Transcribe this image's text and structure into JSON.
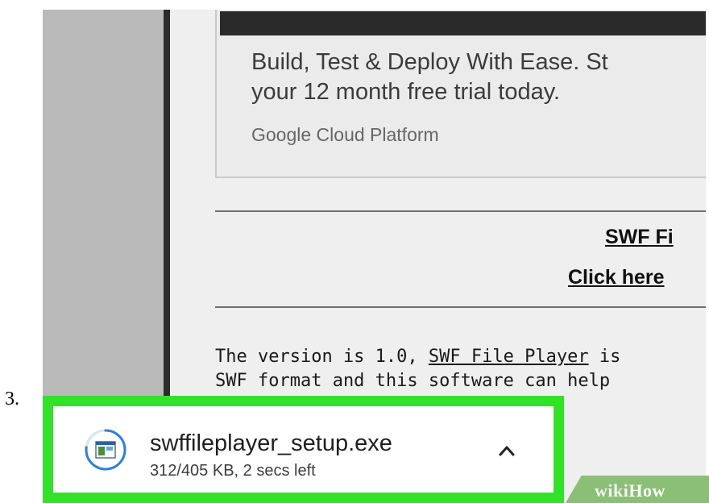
{
  "step": {
    "number": "3."
  },
  "ad": {
    "headline_line1": "Build, Test & Deploy With Ease. St",
    "headline_line2": "your 12 month free trial today.",
    "source": "Google Cloud Platform"
  },
  "links": {
    "title": "SWF Fi",
    "click": "Click here"
  },
  "paragraph": {
    "line1_a": "The version is 1.0, ",
    "line1_link": "SWF File Player",
    "line1_b": " is",
    "line2": "SWF format and this software can help"
  },
  "download": {
    "filename": "swffileplayer_setup.exe",
    "status": "312/405 KB, 2 secs left",
    "icon": "installer-file-icon",
    "chevron_icon": "chevron-up-icon",
    "progress": 0.77,
    "highlight_color": "#34e12a"
  },
  "watermark": {
    "wiki": "wiki",
    "how": "How"
  }
}
